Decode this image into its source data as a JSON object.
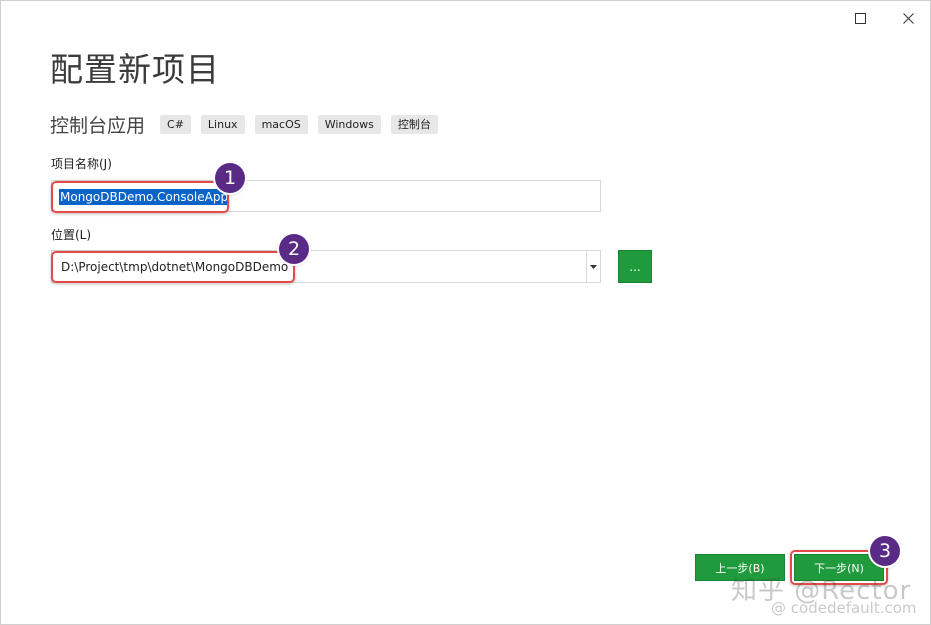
{
  "dialog": {
    "title": "配置新项目",
    "project_type": "控制台应用",
    "tags": [
      "C#",
      "Linux",
      "macOS",
      "Windows",
      "控制台"
    ]
  },
  "form": {
    "name_label": "项目名称(J)",
    "name_value": "MongoDBDemo.ConsoleApp",
    "location_label": "位置(L)",
    "location_value": "D:\\Project\\tmp\\dotnet\\MongoDBDemo",
    "browse_label": "..."
  },
  "footer": {
    "back_label": "上一步(B)",
    "next_label": "下一步(N)"
  },
  "annotations": {
    "badge_1": "1",
    "badge_2": "2",
    "badge_3": "3",
    "highlight_color": "#e34b4b",
    "badge_color": "#5a2b86"
  },
  "watermark": {
    "main": "知乎 @Rector",
    "sub": "@ codedefault.com"
  },
  "colors": {
    "accent_green": "#1f9a3c",
    "selection_blue": "#0a64c8"
  },
  "icons": {
    "maximize": "maximize-icon",
    "close": "close-icon",
    "dropdown": "chevron-down-icon"
  }
}
